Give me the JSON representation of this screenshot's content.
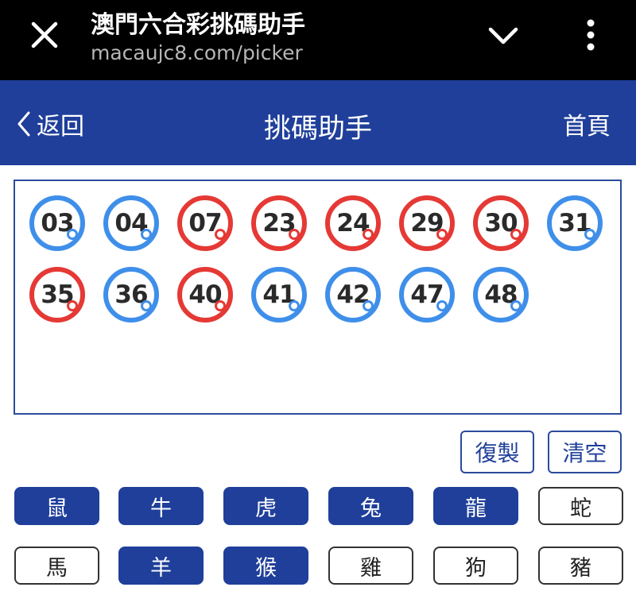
{
  "browser": {
    "title": "澳門六合彩挑碼助手",
    "url": "macaujc8.com/picker",
    "icons": [
      "close-icon",
      "chevron-down-icon",
      "more-vert-icon"
    ]
  },
  "header": {
    "back_label": "返回",
    "title": "挑碼助手",
    "home_label": "首頁"
  },
  "picked_numbers": [
    {
      "number": "03",
      "color": "blue"
    },
    {
      "number": "04",
      "color": "blue"
    },
    {
      "number": "07",
      "color": "red"
    },
    {
      "number": "23",
      "color": "red"
    },
    {
      "number": "24",
      "color": "red"
    },
    {
      "number": "29",
      "color": "red"
    },
    {
      "number": "30",
      "color": "red"
    },
    {
      "number": "31",
      "color": "blue"
    },
    {
      "number": "35",
      "color": "red"
    },
    {
      "number": "36",
      "color": "blue"
    },
    {
      "number": "40",
      "color": "red"
    },
    {
      "number": "41",
      "color": "blue"
    },
    {
      "number": "42",
      "color": "blue"
    },
    {
      "number": "47",
      "color": "blue"
    },
    {
      "number": "48",
      "color": "blue"
    }
  ],
  "actions": {
    "copy_label": "復製",
    "clear_label": "清空"
  },
  "zodiac": [
    {
      "label": "鼠",
      "selected": true
    },
    {
      "label": "牛",
      "selected": true
    },
    {
      "label": "虎",
      "selected": true
    },
    {
      "label": "兔",
      "selected": true
    },
    {
      "label": "龍",
      "selected": true
    },
    {
      "label": "蛇",
      "selected": false
    },
    {
      "label": "馬",
      "selected": false
    },
    {
      "label": "羊",
      "selected": true
    },
    {
      "label": "猴",
      "selected": true
    },
    {
      "label": "雞",
      "selected": false
    },
    {
      "label": "狗",
      "selected": false
    },
    {
      "label": "豬",
      "selected": false
    }
  ],
  "colors": {
    "header_bg": "#1f3f9a",
    "red_ball": "#e53935",
    "blue_ball": "#3f8fea"
  }
}
